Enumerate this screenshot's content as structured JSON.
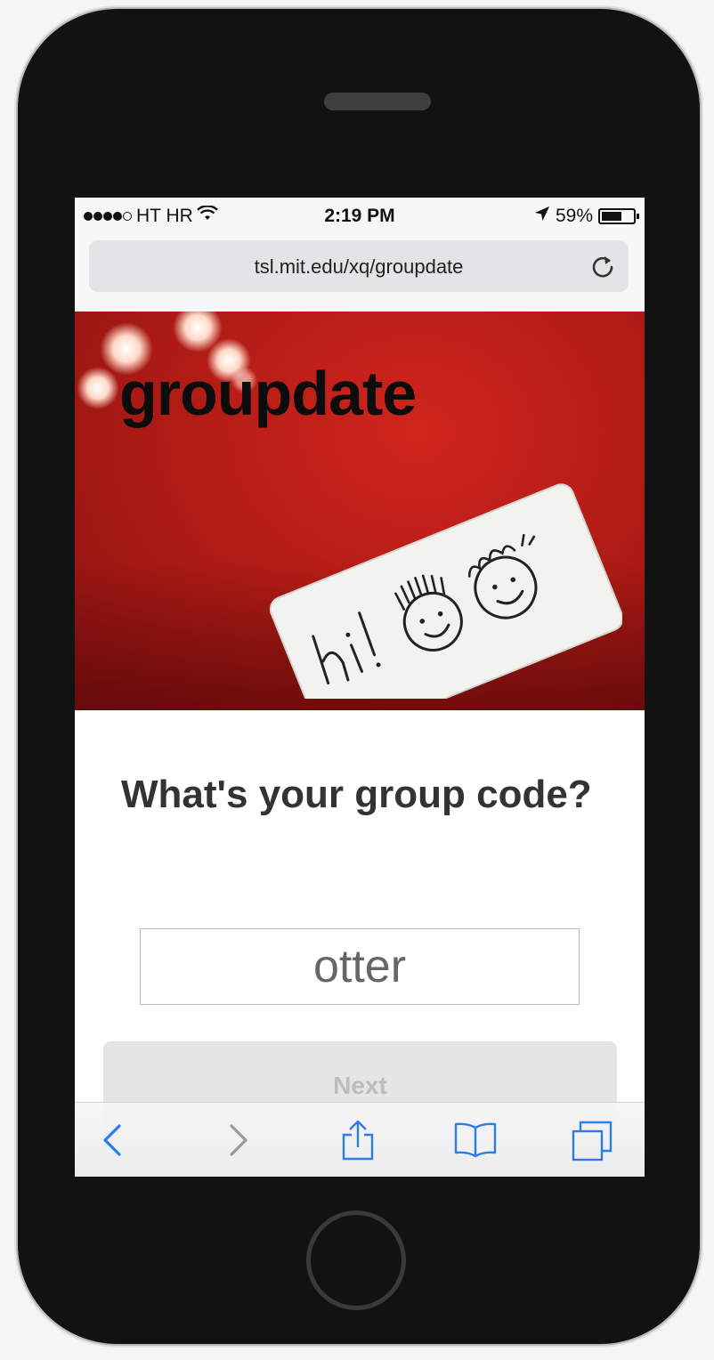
{
  "status_bar": {
    "carrier": "HT HR",
    "time": "2:19 PM",
    "battery_percent": "59%",
    "signal_bars_filled": 4,
    "signal_bars_total": 5
  },
  "browser": {
    "url": "tsl.mit.edu/xq/groupdate"
  },
  "hero": {
    "brand": "groupdate"
  },
  "form": {
    "question": "What's your group code?",
    "code_value": "otter",
    "next_label": "Next"
  },
  "colors": {
    "hero_red": "#c0201a",
    "ios_blue": "#2b7de9",
    "disabled_gray": "#bdbdbd"
  },
  "icons": {
    "back": "chevron-left-icon",
    "forward": "chevron-right-icon",
    "share": "share-icon",
    "bookmarks": "book-icon",
    "tabs": "tabs-icon",
    "reload": "reload-icon"
  }
}
